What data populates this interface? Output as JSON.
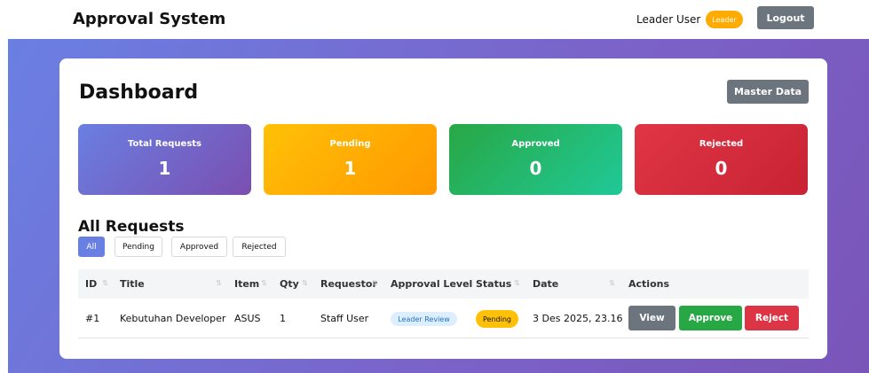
{
  "header": {
    "app_title": "Approval System",
    "user_name": "Leader User",
    "role_badge": "Leader",
    "logout_label": "Logout"
  },
  "dashboard": {
    "title": "Dashboard",
    "master_data_label": "Master Data",
    "stats": {
      "total": {
        "label": "Total Requests",
        "value": "1"
      },
      "pending": {
        "label": "Pending",
        "value": "1"
      },
      "approved": {
        "label": "Approved",
        "value": "0"
      },
      "rejected": {
        "label": "Rejected",
        "value": "0"
      }
    }
  },
  "requests": {
    "title": "All Requests",
    "filters": [
      "All",
      "Pending",
      "Approved",
      "Rejected"
    ],
    "active_filter": "All",
    "columns": {
      "id": "ID",
      "title": "Title",
      "item": "Item",
      "qty": "Qty",
      "requestor": "Requestor",
      "approval_level": "Approval Level",
      "status": "Status",
      "date": "Date",
      "actions": "Actions"
    },
    "sort_glyph": "⇅",
    "rows": [
      {
        "id": "#1",
        "title": "Kebutuhan Developer",
        "item": "ASUS",
        "qty": "1",
        "requestor": "Staff User",
        "approval_level": "Leader Review",
        "status": "Pending",
        "date": "3 Des 2025, 23.16"
      }
    ],
    "actions": {
      "view": "View",
      "approve": "Approve",
      "reject": "Reject"
    }
  },
  "colors": {
    "primary": "#6a7fe2",
    "pending": "#ffc107",
    "approved": "#28a745",
    "rejected": "#dc3545",
    "secondary": "#6c757d"
  }
}
